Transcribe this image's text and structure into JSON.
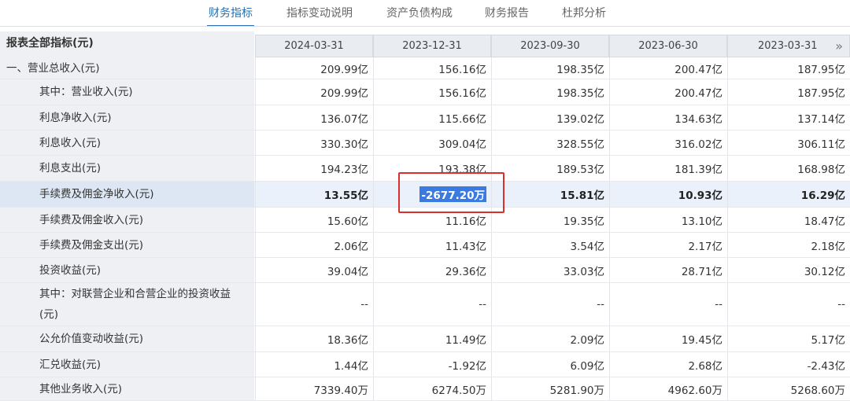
{
  "tabs": [
    "财务指标",
    "指标变动说明",
    "资产负债构成",
    "财务报告",
    "杜邦分析"
  ],
  "header": {
    "label": "报表全部指标(元)",
    "dates": [
      "2024-03-31",
      "2023-12-31",
      "2023-09-30",
      "2023-06-30",
      "2023-03-31"
    ],
    "more_icon": "»"
  },
  "rows": [
    {
      "label": "一、营业总收入(元)",
      "values": [
        "209.99亿",
        "156.16亿",
        "198.35亿",
        "200.47亿",
        "187.95亿"
      ]
    },
    {
      "label": "其中：营业收入(元)",
      "values": [
        "209.99亿",
        "156.16亿",
        "198.35亿",
        "200.47亿",
        "187.95亿"
      ]
    },
    {
      "label": "利息净收入(元)",
      "values": [
        "136.07亿",
        "115.66亿",
        "139.02亿",
        "134.63亿",
        "137.14亿"
      ]
    },
    {
      "label": "利息收入(元)",
      "values": [
        "330.30亿",
        "309.04亿",
        "328.55亿",
        "316.02亿",
        "306.11亿"
      ]
    },
    {
      "label": "利息支出(元)",
      "values": [
        "194.23亿",
        "193.38亿",
        "189.53亿",
        "181.39亿",
        "168.98亿"
      ]
    },
    {
      "label": "手续费及佣金净收入(元)",
      "values": [
        "13.55亿",
        "-2677.20万",
        "15.81亿",
        "10.93亿",
        "16.29亿"
      ]
    },
    {
      "label": "手续费及佣金收入(元)",
      "values": [
        "15.60亿",
        "11.16亿",
        "19.35亿",
        "13.10亿",
        "18.47亿"
      ]
    },
    {
      "label": "手续费及佣金支出(元)",
      "values": [
        "2.06亿",
        "11.43亿",
        "3.54亿",
        "2.17亿",
        "2.18亿"
      ]
    },
    {
      "label": "投资收益(元)",
      "values": [
        "39.04亿",
        "29.36亿",
        "33.03亿",
        "28.71亿",
        "30.12亿"
      ]
    },
    {
      "label": "其中：对联营企业和合营企业的投资收益",
      "label2": "(元)",
      "values": [
        "--",
        "--",
        "--",
        "--",
        "--"
      ]
    },
    {
      "label": "公允价值变动收益(元)",
      "values": [
        "18.36亿",
        "11.49亿",
        "2.09亿",
        "19.45亿",
        "5.17亿"
      ]
    },
    {
      "label": "汇兑收益(元)",
      "values": [
        "1.44亿",
        "-1.92亿",
        "6.09亿",
        "2.68亿",
        "-2.43亿"
      ]
    },
    {
      "label": "其他业务收入(元)",
      "values": [
        "7339.40万",
        "6274.50万",
        "5281.90万",
        "4962.60万",
        "5268.60万"
      ]
    }
  ],
  "highlight_color": "#3b7ae0",
  "annotation_color": "#d9302c"
}
